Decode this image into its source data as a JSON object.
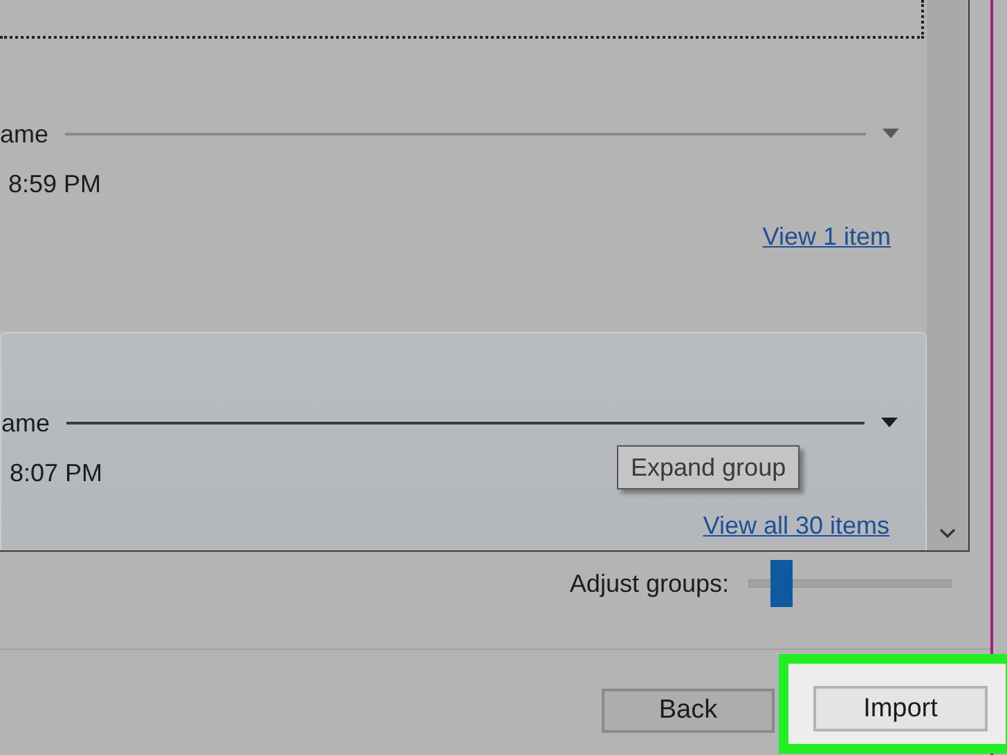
{
  "groups": [
    {
      "label": "ame",
      "time": "8:59 PM",
      "link": "View 1 item",
      "highlighted": false
    },
    {
      "label": "ame",
      "time": "8:07 PM",
      "link": "View all 30 items",
      "highlighted": true
    }
  ],
  "tooltip": {
    "text": "Expand group"
  },
  "adjust_groups": {
    "label": "Adjust groups:",
    "level": 0.16
  },
  "buttons": [
    {
      "label": "Back",
      "highlighted": false
    },
    {
      "label": "Import",
      "highlighted": true
    }
  ]
}
